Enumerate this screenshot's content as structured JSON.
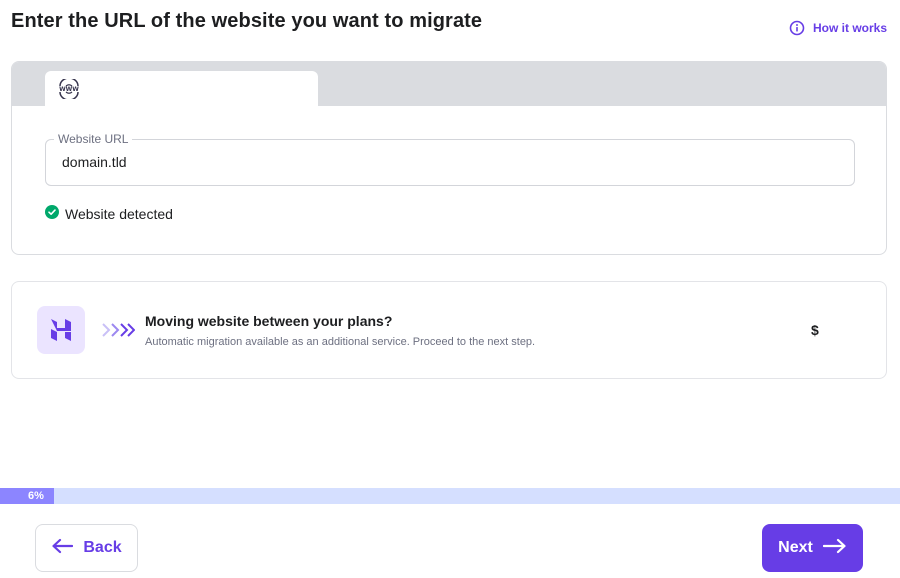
{
  "header": {
    "title": "Enter the URL of the website you want to migrate",
    "how_it_works": "How it works"
  },
  "url_card": {
    "field_label": "Website URL",
    "field_value": "domain.tld",
    "status_text": "Website detected"
  },
  "move_card": {
    "title": "Moving website between your plans?",
    "subtitle": "Automatic migration available as an additional service. Proceed to the next step.",
    "price_symbol": "$"
  },
  "progress": {
    "label": "6%",
    "value": 0.06
  },
  "footer": {
    "back_label": "Back",
    "next_label": "Next"
  },
  "colors": {
    "accent": "#673de6",
    "success": "#00a86b",
    "progress_track": "#d5dfff",
    "progress_fill": "#8c85ff"
  },
  "icons": {
    "info": "info-circle-icon",
    "tab": "www-globe-icon",
    "status": "check-circle-icon",
    "brand": "hostinger-logo-icon",
    "chevrons": "triple-chevron-right-icon",
    "back": "arrow-left-icon",
    "next": "arrow-right-icon"
  }
}
